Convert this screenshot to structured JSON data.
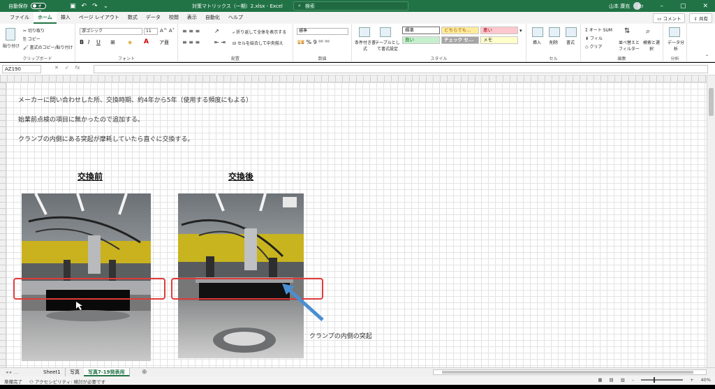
{
  "titlebar": {
    "autosave_label": "自動保存",
    "autosave_state": "オフ",
    "doc_title": "対策マトリックス（一期）2.xlsx - Excel",
    "search_placeholder": "検索",
    "user_name": "山本 康充"
  },
  "tabs": [
    "ファイル",
    "ホーム",
    "挿入",
    "ページ レイアウト",
    "数式",
    "データ",
    "校閲",
    "表示",
    "自動化",
    "ヘルプ"
  ],
  "tabs_active": "ホーム",
  "ribbon_right": {
    "comment": "コメント",
    "share": "共有"
  },
  "ribbon": {
    "clipboard": {
      "paste": "貼り付け",
      "cut": "切り取り",
      "copy": "コピー",
      "format_painter": "書式のコピー/貼り付け",
      "label": "クリップボード"
    },
    "font": {
      "name": "游ゴシック",
      "size": "11",
      "label": "フォント"
    },
    "alignment": {
      "wrap": "折り返して全体を表示する",
      "merge": "セルを結合して中央揃え",
      "label": "配置"
    },
    "number": {
      "format": "標準",
      "label": "数値"
    },
    "styles": {
      "conditional": "条件付き書式",
      "table": "テーブルとして書式設定",
      "cells": [
        "標準",
        "どちらでも...",
        "悪い",
        "良い",
        "チェック セ...",
        "メモ"
      ],
      "label": "スタイル"
    },
    "cells": {
      "insert": "挿入",
      "delete": "削除",
      "format": "書式",
      "label": "セル"
    },
    "editing": {
      "autosum": "オート SUM",
      "fill": "フィル",
      "clear": "クリア",
      "sort": "並べ替えとフィルター",
      "find": "検索と選択",
      "label": "編集"
    },
    "analysis": {
      "data": "データ分析",
      "label": "分析"
    }
  },
  "formula_bar": {
    "cell_ref": "AZ190",
    "content": ""
  },
  "sheet": {
    "notes": [
      "メーカーに問い合わせした所、交換時期、約4年から5年（使用する頻度にもよる）",
      "始業前点検の項目に無かったので追加する。",
      "クランプの内側にある突起が摩耗していたら直ぐに交換する。"
    ],
    "before_heading": "交換前",
    "after_heading": "交換後",
    "annotation": "クランプの内側の突起"
  },
  "sheet_tabs": [
    "Sheet1",
    "写真",
    "写真7-19発表用"
  ],
  "sheet_tabs_active": "写真7-19発表用",
  "status": {
    "ready": "準備完了",
    "accessibility": "アクセシビリティ: 検討が必要です",
    "zoom": "40%"
  },
  "colors": {
    "accent": "#217346",
    "highlight_box": "#e03a3a",
    "arrow": "#4a8fd0"
  }
}
